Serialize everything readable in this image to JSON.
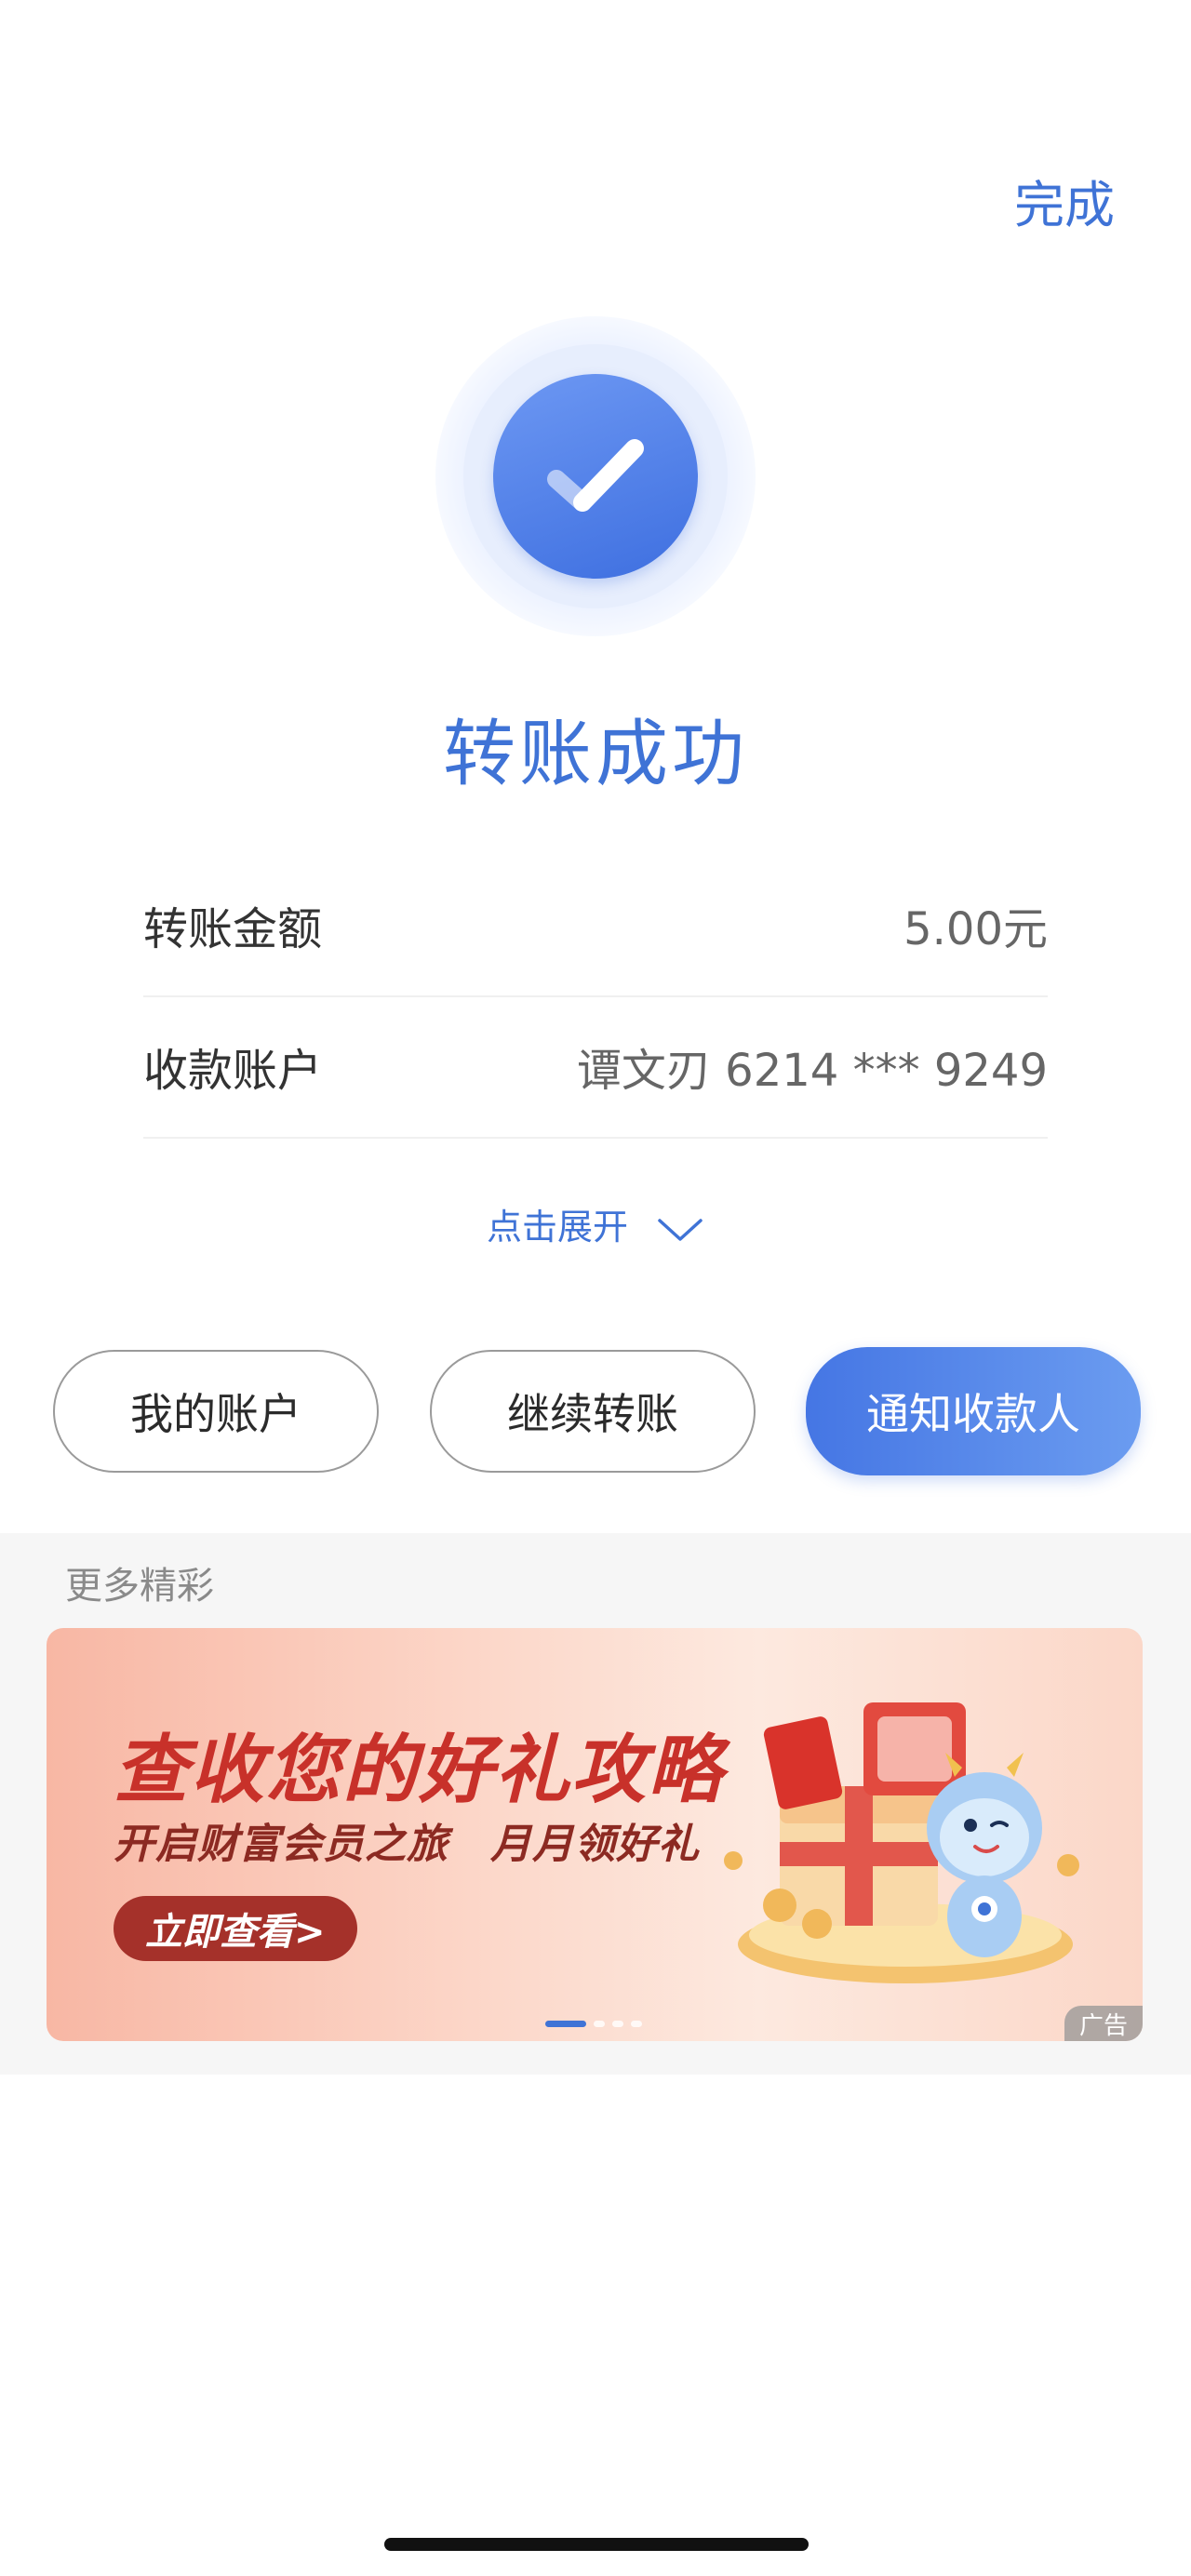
{
  "header": {
    "done_label": "完成"
  },
  "result": {
    "icon": "checkmark-circle-icon",
    "title": "转账成功"
  },
  "details": {
    "amount_label": "转账金额",
    "amount_value": "5.00元",
    "account_label": "收款账户",
    "account_value": "谭文刃 6214 *** 9249"
  },
  "expand": {
    "label": "点击展开",
    "icon": "chevron-down-icon"
  },
  "actions": {
    "my_account": "我的账户",
    "continue_transfer": "继续转账",
    "notify_payee": "通知收款人"
  },
  "more": {
    "title": "更多精彩",
    "banner": {
      "headline": "查收您的好礼攻略",
      "subline": "开启财富会员之旅　月月领好礼",
      "cta": "立即查看>",
      "ad_tag": "广告",
      "slides_total": 4,
      "slide_active": 1
    }
  },
  "colors": {
    "accent": "#3f73d6",
    "primary_button": "#4576e4",
    "banner_headline": "#c8312a"
  }
}
